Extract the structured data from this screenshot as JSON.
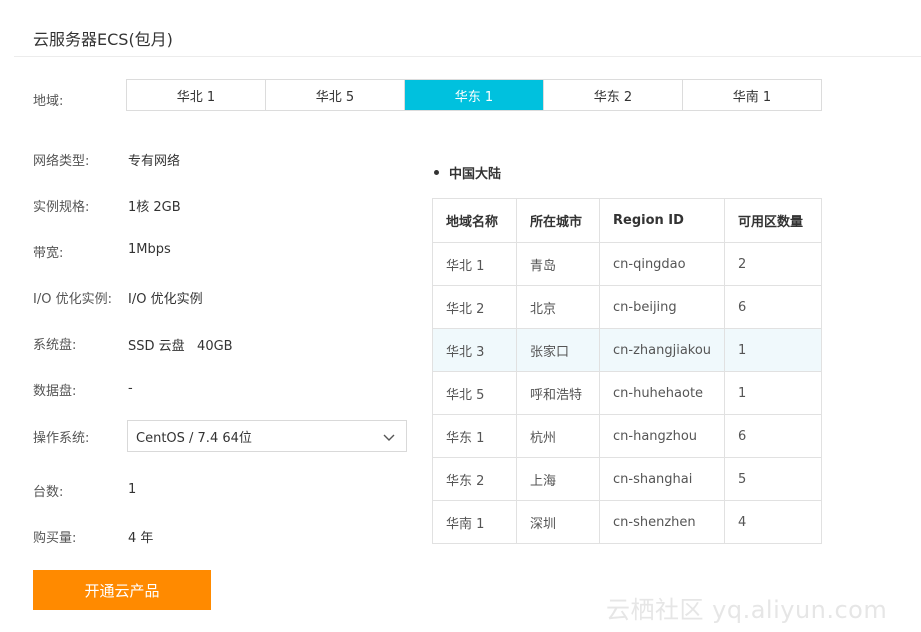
{
  "header": {
    "title": "云服务器ECS(包月)"
  },
  "region": {
    "label": "地域:",
    "tabs": [
      "华北 1",
      "华北 5",
      "华东 1",
      "华东 2",
      "华南 1"
    ],
    "selected_index": 2
  },
  "fields": [
    {
      "label": "网络类型:",
      "value": "专有网络"
    },
    {
      "label": "实例规格:",
      "value": "1核 2GB"
    },
    {
      "label": "带宽:",
      "value": "1Mbps"
    },
    {
      "label": "I/O 优化实例:",
      "value": "I/O 优化实例"
    },
    {
      "label": "系统盘:",
      "value": "SSD 云盘   40GB"
    },
    {
      "label": "数据盘:",
      "value": "-"
    },
    {
      "label": "操作系统:",
      "value": "CentOS / 7.4 64位"
    },
    {
      "label": "台数:",
      "value": "1"
    },
    {
      "label": "购买量:",
      "value": "4 年"
    }
  ],
  "buy_button": "开通云产品",
  "table": {
    "heading": "中国大陆",
    "columns": [
      "地域名称",
      "所在城市",
      "Region ID",
      "可用区数量"
    ],
    "rows": [
      [
        "华北 1",
        "青岛",
        "cn-qingdao",
        "2"
      ],
      [
        "华北 2",
        "北京",
        "cn-beijing",
        "6"
      ],
      [
        "华北 3",
        "张家口",
        "cn-zhangjiakou",
        "1"
      ],
      [
        "华北 5",
        "呼和浩特",
        "cn-huhehaote",
        "1"
      ],
      [
        "华东 1",
        "杭州",
        "cn-hangzhou",
        "6"
      ],
      [
        "华东 2",
        "上海",
        "cn-shanghai",
        "5"
      ],
      [
        "华南 1",
        "深圳",
        "cn-shenzhen",
        "4"
      ]
    ],
    "highlighted_row": 2
  },
  "watermark": "云栖社区 yq.aliyun.com",
  "colors": {
    "accent": "#00c1de",
    "buy": "#ff8a00",
    "row_highlight": "#f0f9fc"
  }
}
